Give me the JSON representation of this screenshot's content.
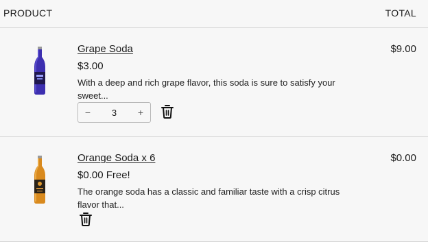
{
  "header": {
    "product_label": "PRODUCT",
    "total_label": "TOTAL"
  },
  "items": [
    {
      "name": "Grape Soda",
      "price": "$3.00",
      "description": "With a deep and rich grape flavor, this soda is sure to satisfy your sweet...",
      "quantity": "3",
      "minus_symbol": "−",
      "plus_symbol": "+",
      "total": "$9.00",
      "bottle_color": "#3d2fb0"
    },
    {
      "name": "Orange Soda x 6",
      "price": "$0.00 Free!",
      "description": "The orange soda has a classic and familiar taste with a crisp citrus flavor that...",
      "total": "$0.00",
      "bottle_color": "#d98a1e"
    }
  ]
}
